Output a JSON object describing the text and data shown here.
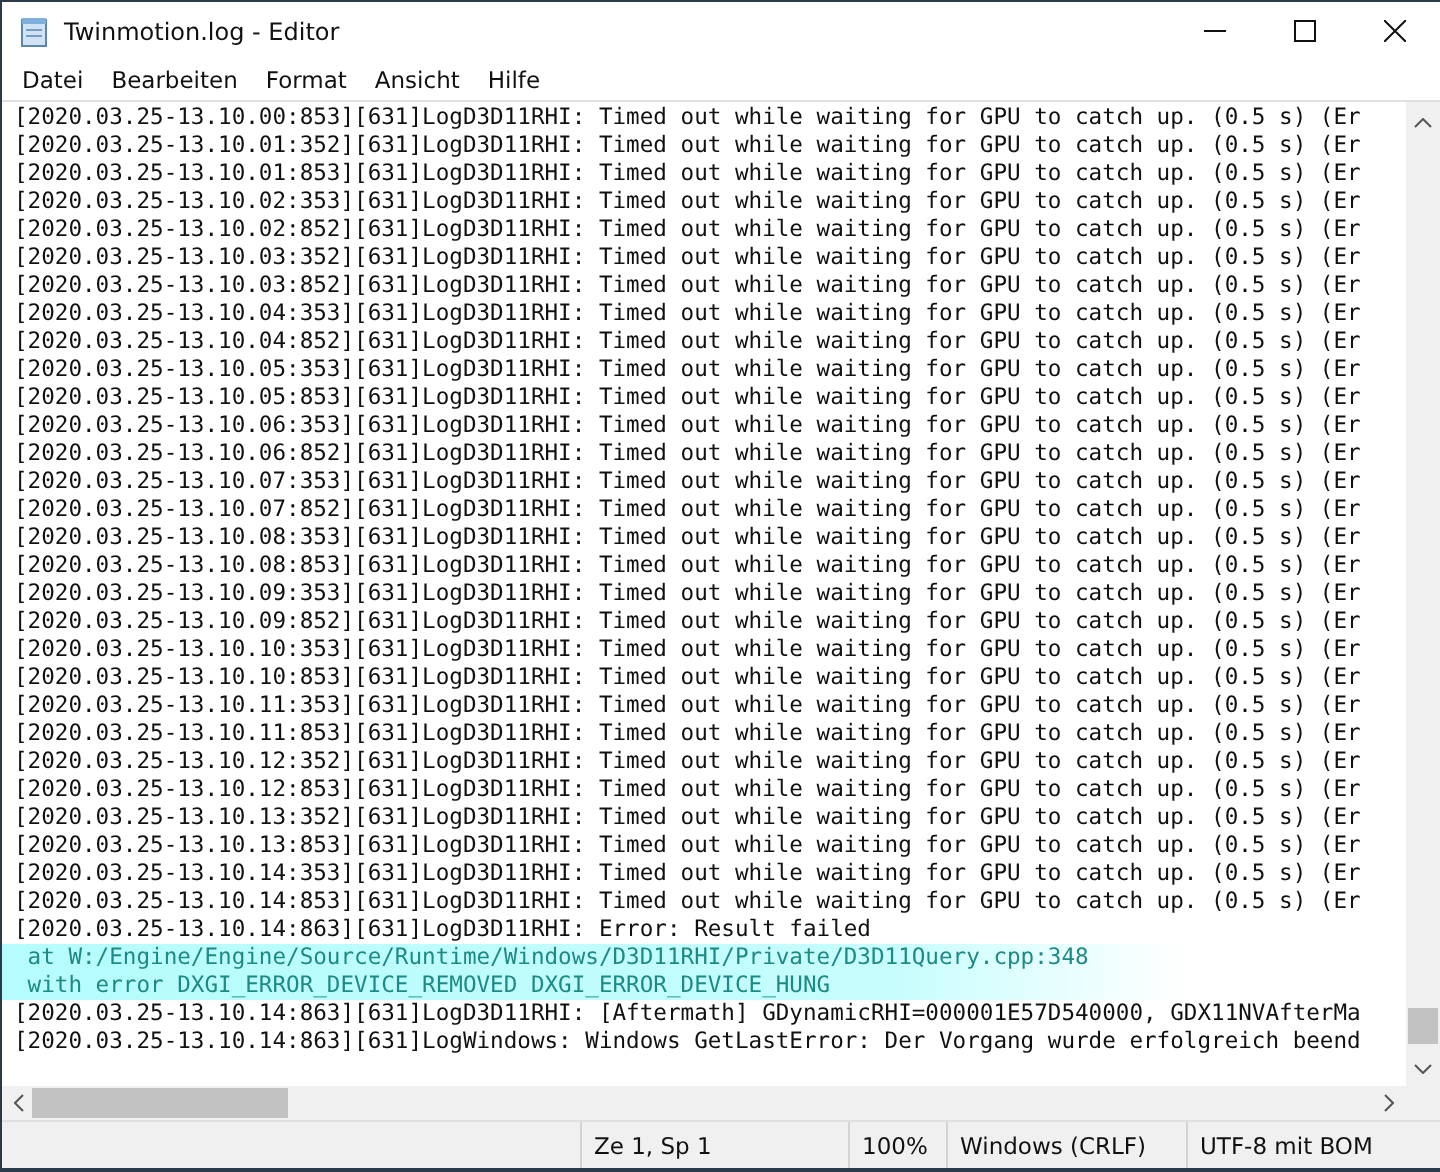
{
  "window": {
    "title": "Twinmotion.log - Editor"
  },
  "menu": [
    "Datei",
    "Bearbeiten",
    "Format",
    "Ansicht",
    "Hilfe"
  ],
  "lines": [
    {
      "kind": "normal",
      "text": "[2020.03.25-13.10.00:853][631]LogD3D11RHI: Timed out while waiting for GPU to catch up. (0.5 s) (Er"
    },
    {
      "kind": "normal",
      "text": "[2020.03.25-13.10.01:352][631]LogD3D11RHI: Timed out while waiting for GPU to catch up. (0.5 s) (Er"
    },
    {
      "kind": "normal",
      "text": "[2020.03.25-13.10.01:853][631]LogD3D11RHI: Timed out while waiting for GPU to catch up. (0.5 s) (Er"
    },
    {
      "kind": "normal",
      "text": "[2020.03.25-13.10.02:353][631]LogD3D11RHI: Timed out while waiting for GPU to catch up. (0.5 s) (Er"
    },
    {
      "kind": "normal",
      "text": "[2020.03.25-13.10.02:852][631]LogD3D11RHI: Timed out while waiting for GPU to catch up. (0.5 s) (Er"
    },
    {
      "kind": "normal",
      "text": "[2020.03.25-13.10.03:352][631]LogD3D11RHI: Timed out while waiting for GPU to catch up. (0.5 s) (Er"
    },
    {
      "kind": "normal",
      "text": "[2020.03.25-13.10.03:852][631]LogD3D11RHI: Timed out while waiting for GPU to catch up. (0.5 s) (Er"
    },
    {
      "kind": "normal",
      "text": "[2020.03.25-13.10.04:353][631]LogD3D11RHI: Timed out while waiting for GPU to catch up. (0.5 s) (Er"
    },
    {
      "kind": "normal",
      "text": "[2020.03.25-13.10.04:852][631]LogD3D11RHI: Timed out while waiting for GPU to catch up. (0.5 s) (Er"
    },
    {
      "kind": "normal",
      "text": "[2020.03.25-13.10.05:353][631]LogD3D11RHI: Timed out while waiting for GPU to catch up. (0.5 s) (Er"
    },
    {
      "kind": "normal",
      "text": "[2020.03.25-13.10.05:853][631]LogD3D11RHI: Timed out while waiting for GPU to catch up. (0.5 s) (Er"
    },
    {
      "kind": "normal",
      "text": "[2020.03.25-13.10.06:353][631]LogD3D11RHI: Timed out while waiting for GPU to catch up. (0.5 s) (Er"
    },
    {
      "kind": "normal",
      "text": "[2020.03.25-13.10.06:852][631]LogD3D11RHI: Timed out while waiting for GPU to catch up. (0.5 s) (Er"
    },
    {
      "kind": "normal",
      "text": "[2020.03.25-13.10.07:353][631]LogD3D11RHI: Timed out while waiting for GPU to catch up. (0.5 s) (Er"
    },
    {
      "kind": "normal",
      "text": "[2020.03.25-13.10.07:852][631]LogD3D11RHI: Timed out while waiting for GPU to catch up. (0.5 s) (Er"
    },
    {
      "kind": "normal",
      "text": "[2020.03.25-13.10.08:353][631]LogD3D11RHI: Timed out while waiting for GPU to catch up. (0.5 s) (Er"
    },
    {
      "kind": "normal",
      "text": "[2020.03.25-13.10.08:853][631]LogD3D11RHI: Timed out while waiting for GPU to catch up. (0.5 s) (Er"
    },
    {
      "kind": "normal",
      "text": "[2020.03.25-13.10.09:353][631]LogD3D11RHI: Timed out while waiting for GPU to catch up. (0.5 s) (Er"
    },
    {
      "kind": "normal",
      "text": "[2020.03.25-13.10.09:852][631]LogD3D11RHI: Timed out while waiting for GPU to catch up. (0.5 s) (Er"
    },
    {
      "kind": "normal",
      "text": "[2020.03.25-13.10.10:353][631]LogD3D11RHI: Timed out while waiting for GPU to catch up. (0.5 s) (Er"
    },
    {
      "kind": "normal",
      "text": "[2020.03.25-13.10.10:853][631]LogD3D11RHI: Timed out while waiting for GPU to catch up. (0.5 s) (Er"
    },
    {
      "kind": "normal",
      "text": "[2020.03.25-13.10.11:353][631]LogD3D11RHI: Timed out while waiting for GPU to catch up. (0.5 s) (Er"
    },
    {
      "kind": "normal",
      "text": "[2020.03.25-13.10.11:853][631]LogD3D11RHI: Timed out while waiting for GPU to catch up. (0.5 s) (Er"
    },
    {
      "kind": "normal",
      "text": "[2020.03.25-13.10.12:352][631]LogD3D11RHI: Timed out while waiting for GPU to catch up. (0.5 s) (Er"
    },
    {
      "kind": "normal",
      "text": "[2020.03.25-13.10.12:853][631]LogD3D11RHI: Timed out while waiting for GPU to catch up. (0.5 s) (Er"
    },
    {
      "kind": "normal",
      "text": "[2020.03.25-13.10.13:352][631]LogD3D11RHI: Timed out while waiting for GPU to catch up. (0.5 s) (Er"
    },
    {
      "kind": "normal",
      "text": "[2020.03.25-13.10.13:853][631]LogD3D11RHI: Timed out while waiting for GPU to catch up. (0.5 s) (Er"
    },
    {
      "kind": "normal",
      "text": "[2020.03.25-13.10.14:353][631]LogD3D11RHI: Timed out while waiting for GPU to catch up. (0.5 s) (Er"
    },
    {
      "kind": "normal",
      "text": "[2020.03.25-13.10.14:853][631]LogD3D11RHI: Timed out while waiting for GPU to catch up. (0.5 s) (Er"
    },
    {
      "kind": "normal",
      "text": "[2020.03.25-13.10.14:863][631]LogD3D11RHI: Error: Result failed"
    },
    {
      "kind": "highlight",
      "text": " at W:/Engine/Engine/Source/Runtime/Windows/D3D11RHI/Private/D3D11Query.cpp:348"
    },
    {
      "kind": "highlight",
      "text": " with error DXGI_ERROR_DEVICE_REMOVED DXGI_ERROR_DEVICE_HUNG"
    },
    {
      "kind": "normal",
      "text": "[2020.03.25-13.10.14:863][631]LogD3D11RHI: [Aftermath] GDynamicRHI=000001E57D540000, GDX11NVAfterMa"
    },
    {
      "kind": "normal",
      "text": "[2020.03.25-13.10.14:863][631]LogWindows: Windows GetLastError: Der Vorgang wurde erfolgreich beend"
    }
  ],
  "status_bar": [
    "Ze 1, Sp 1",
    "100%",
    "Windows (CRLF)",
    "UTF-8 mit BOM"
  ]
}
